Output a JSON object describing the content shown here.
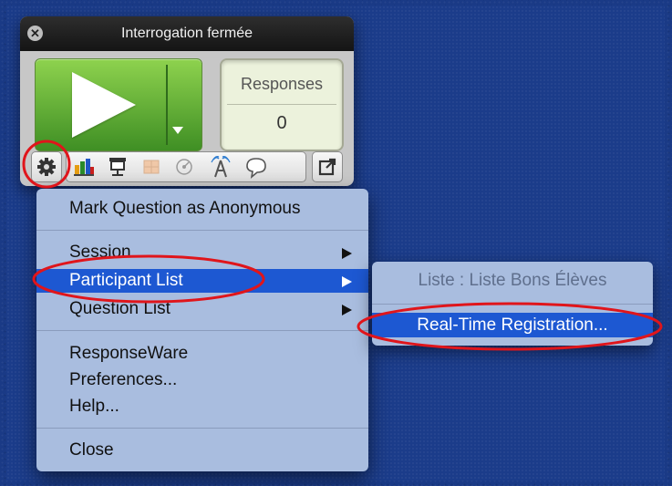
{
  "panel": {
    "title": "Interrogation fermée",
    "responses_label": "Responses",
    "responses_value": "0",
    "close_icon": "close-icon",
    "toolbar_icons": [
      "gear-icon",
      "bar-chart-icon",
      "presentation-icon",
      "grid-icon",
      "chart-dial-icon",
      "antenna-icon",
      "speech-bubble-icon",
      "share-icon"
    ]
  },
  "menu": {
    "items": [
      {
        "label": "Mark Question as Anonymous"
      },
      {
        "label": "Session"
      },
      {
        "label": "Participant List"
      },
      {
        "label": "Question List"
      },
      {
        "label": "ResponseWare"
      },
      {
        "label": "Preferences..."
      },
      {
        "label": "Help..."
      },
      {
        "label": "Close"
      }
    ],
    "active_item": "Participant List"
  },
  "submenu": {
    "list_label": "Liste : Liste Bons Élèves",
    "registration_label": "Real-Time Registration..."
  },
  "colors": {
    "highlight": "#1d58d2",
    "annotation": "#e0151b",
    "play_green": "#5cb032",
    "desktop": "#1a3a86"
  }
}
